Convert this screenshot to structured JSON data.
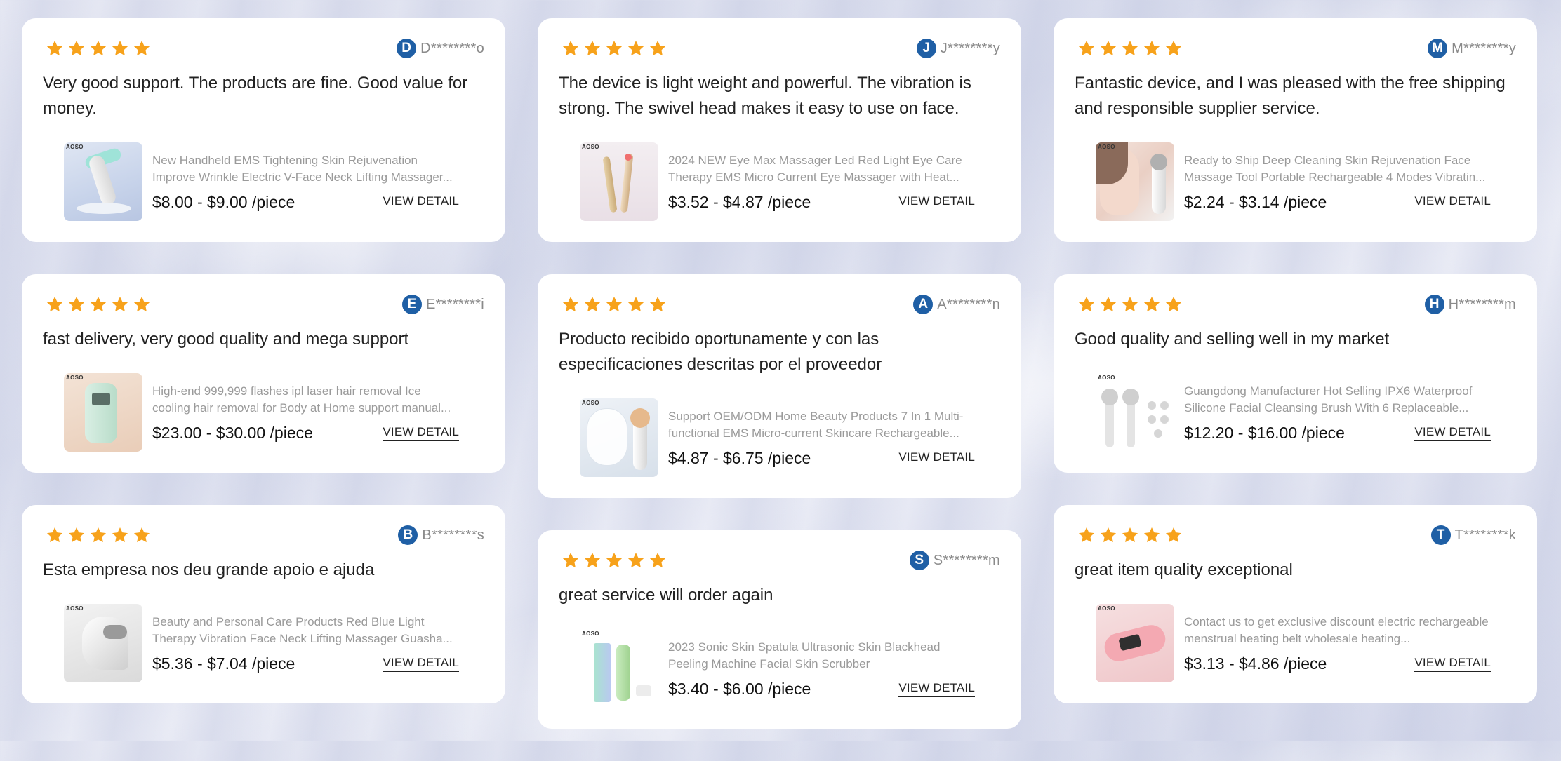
{
  "colors": {
    "star": "#f7a21b",
    "avatar_bg": "#1f5fa5",
    "card_bg": "#ffffff"
  },
  "rating_icon": "star-icon",
  "columns": [
    {
      "cards": [
        {
          "rating": 5,
          "avatar_letter": "D",
          "reviewer": "D********o",
          "review": "Very good support. The products are fine. Good value for money.",
          "product_name": "New Handheld EMS Tightening Skin Rejuvenation Improve Wrinkle Electric V-Face Neck Lifting Massager...",
          "price": "$8.00 - $9.00 /piece",
          "action": "VIEW DETAIL",
          "brand": "AOSO"
        },
        {
          "rating": 5,
          "avatar_letter": "E",
          "reviewer": "E********i",
          "review": "fast delivery, very good quality and mega support",
          "product_name": "High-end 999,999 flashes ipl laser hair removal Ice cooling hair removal for Body at Home support manual...",
          "price": "$23.00 - $30.00 /piece",
          "action": "VIEW DETAIL",
          "brand": "AOSO"
        },
        {
          "rating": 5,
          "avatar_letter": "B",
          "reviewer": "B********s",
          "review": "Esta empresa nos deu grande apoio e ajuda",
          "product_name": "Beauty and Personal Care Products Red Blue Light Therapy Vibration Face Neck Lifting Massager Guasha...",
          "price": "$5.36 - $7.04 /piece",
          "action": "VIEW DETAIL",
          "brand": "AOSO"
        }
      ]
    },
    {
      "cards": [
        {
          "rating": 5,
          "avatar_letter": "J",
          "reviewer": "J********y",
          "review": "The device is light weight and powerful. The vibration is strong. The swivel head makes it easy to use on face.",
          "product_name": "2024 NEW Eye Max Massager Led Red Light Eye Care Therapy EMS Micro Current Eye Massager with Heat...",
          "price": "$3.52 - $4.87 /piece",
          "action": "VIEW DETAIL",
          "brand": "AOSO"
        },
        {
          "rating": 5,
          "avatar_letter": "A",
          "reviewer": "A********n",
          "review": "Producto recibido oportunamente y con las especificaciones descritas por el proveedor",
          "product_name": "Support OEM/ODM Home Beauty Products 7 In 1 Multi-functional EMS Micro-current Skincare Rechargeable...",
          "price": "$4.87 - $6.75 /piece",
          "action": "VIEW DETAIL",
          "brand": "AOSO"
        },
        {
          "rating": 5,
          "avatar_letter": "S",
          "reviewer": "S********m",
          "review": "great service will order again",
          "product_name": "2023 Sonic Skin Spatula Ultrasonic Skin Blackhead Peeling Machine Facial Skin Scrubber",
          "price": "$3.40 - $6.00 /piece",
          "action": "VIEW DETAIL",
          "brand": "AOSO"
        }
      ]
    },
    {
      "cards": [
        {
          "rating": 5,
          "avatar_letter": "M",
          "reviewer": "M********y",
          "review": "Fantastic device, and I was pleased with the free shipping and responsible supplier service.",
          "product_name": "Ready to Ship Deep Cleaning Skin Rejuvenation Face Massage Tool Portable Rechargeable 4 Modes Vibratin...",
          "price": "$2.24 - $3.14 /piece",
          "action": "VIEW DETAIL",
          "brand": "AOSO"
        },
        {
          "rating": 5,
          "avatar_letter": "H",
          "reviewer": "H********m",
          "review": "Good quality and selling well in my market",
          "product_name": "Guangdong Manufacturer Hot Selling IPX6 Waterproof Silicone Facial Cleansing Brush With 6 Replaceable...",
          "price": "$12.20 - $16.00 /piece",
          "action": "VIEW DETAIL",
          "brand": "AOSO"
        },
        {
          "rating": 5,
          "avatar_letter": "T",
          "reviewer": "T********k",
          "review": "great item quality exceptional",
          "product_name": "Contact us to get exclusive discount electric rechargeable menstrual heating belt wholesale heating...",
          "price": "$3.13 - $4.86 /piece",
          "action": "VIEW DETAIL",
          "brand": "AOSO"
        }
      ]
    }
  ]
}
